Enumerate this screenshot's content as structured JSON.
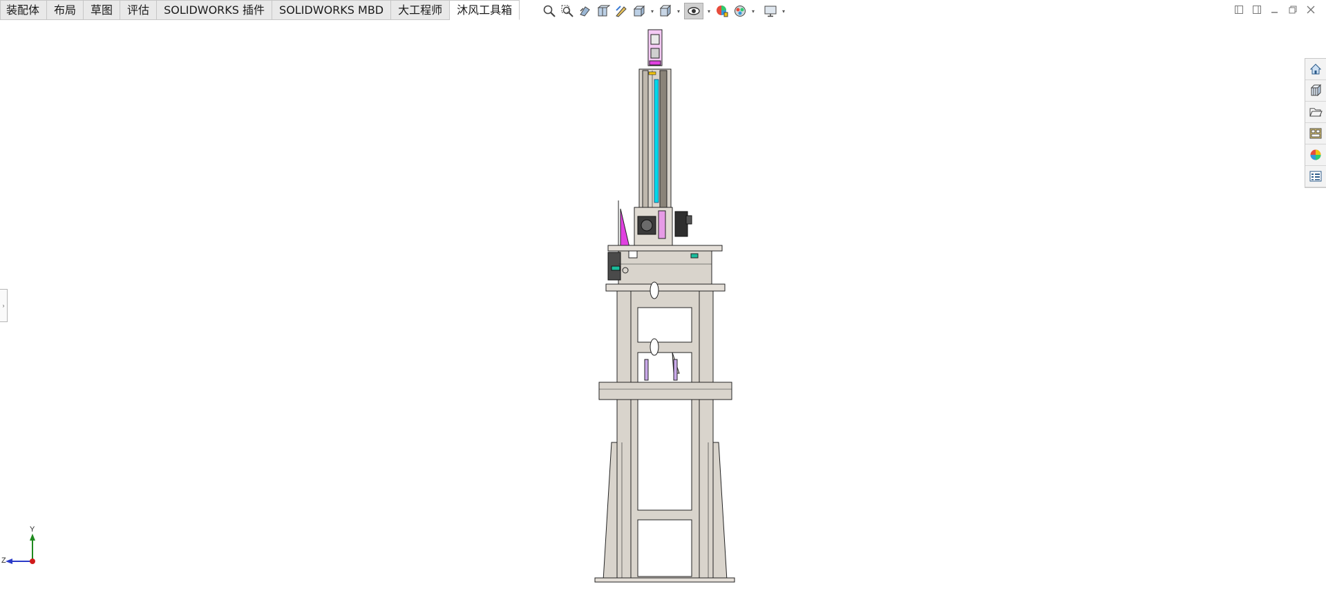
{
  "tabs": [
    {
      "label": "装配体",
      "active": false
    },
    {
      "label": "布局",
      "active": false
    },
    {
      "label": "草图",
      "active": false
    },
    {
      "label": "评估",
      "active": false
    },
    {
      "label": "SOLIDWORKS 插件",
      "active": false
    },
    {
      "label": "SOLIDWORKS MBD",
      "active": false
    },
    {
      "label": "大工程师",
      "active": false
    },
    {
      "label": "沐风工具箱",
      "active": true
    }
  ],
  "heads_up_toolbar": [
    "zoom-to-fit-icon",
    "zoom-to-area-icon",
    "previous-view-icon",
    "section-view-icon",
    "dynamic-annotation-icon",
    "view-orientation-icon",
    "display-style-icon",
    "hide-show-items-icon",
    "edit-appearance-icon",
    "apply-scene-icon",
    "view-settings-icon"
  ],
  "task_pane": [
    "solidworks-resources-icon",
    "design-library-icon",
    "file-explorer-icon",
    "view-palette-icon",
    "appearances-scenes-icon",
    "custom-properties-icon"
  ],
  "triad": {
    "y_label": "Y",
    "z_label": "Z"
  },
  "colors": {
    "accent_pink": "#e040e0",
    "accent_cyan": "#00d8e8",
    "frame": "#d9d4cc",
    "tab_bg": "#e9e9e9"
  }
}
